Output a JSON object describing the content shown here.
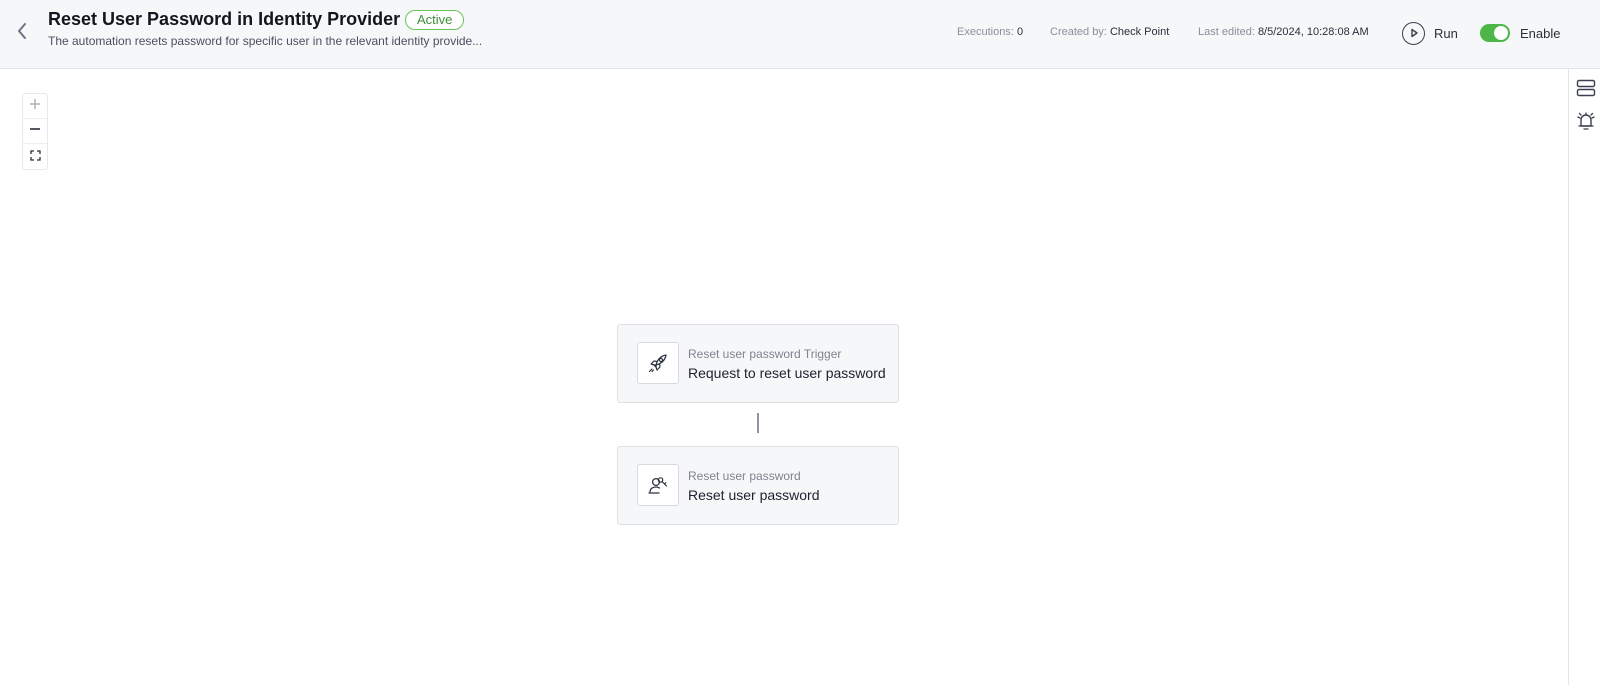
{
  "header": {
    "title": "Reset User Password in Identity Provider",
    "status": "Active",
    "description": "The automation resets password for specific user in the relevant identity provide...",
    "executions_label": "Executions:",
    "executions_value": "0",
    "created_by_label": "Created by:",
    "created_by_value": "Check Point",
    "last_edited_label": "Last edited:",
    "last_edited_value": "8/5/2024, 10:28:08 AM",
    "run_label": "Run",
    "enable_label": "Enable",
    "enabled": true
  },
  "nodes": [
    {
      "label": "Reset user password Trigger",
      "name": "Request to reset user password",
      "icon": "rocket-icon"
    },
    {
      "label": "Reset user password",
      "name": "Reset user password",
      "icon": "user-key-icon"
    }
  ],
  "icons": {
    "back": "chevron-left-icon",
    "run": "play-circle-icon",
    "zoom_in": "plus-icon",
    "zoom_out": "minus-icon",
    "fit": "fit-screen-icon",
    "rail_top": "panels-icon",
    "rail_bottom": "alarm-icon"
  },
  "colors": {
    "accent_green": "#4cb648",
    "badge_green": "#6cc25a",
    "header_bg": "#f6f7f9",
    "node_bg": "#f6f7f9",
    "connector": "#8c93a3"
  }
}
